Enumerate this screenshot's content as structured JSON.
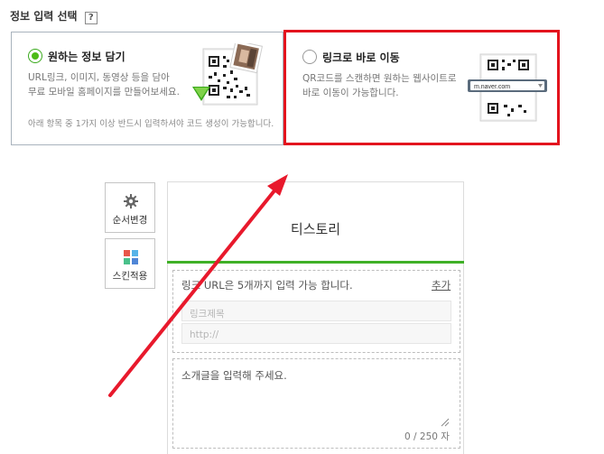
{
  "section": {
    "title": "정보 입력 선택",
    "help": "?"
  },
  "options": [
    {
      "title": "원하는 정보 담기",
      "desc_line1": "URL링크, 이미지, 동영상 등을 담아",
      "desc_line2": "무료 모바일 홈페이지를 만들어보세요.",
      "note": "아래 항목 중 1가지 이상 반드시 입력하셔야 코드 생성이 가능합니다.",
      "selected": true
    },
    {
      "title": "링크로 바로 이동",
      "desc_line1": "QR코드를 스캔하면 원하는 웹사이트로",
      "desc_line2": "바로 이동이 가능합니다.",
      "url_sample": "m.naver.com",
      "selected": false
    }
  ],
  "side_buttons": [
    {
      "label": "순서변경",
      "icon": "gear-icon"
    },
    {
      "label": "스킨적용",
      "icon": "skin-grid-icon"
    }
  ],
  "editor": {
    "title": "티스토리",
    "link_info": "링크 URL은 5개까지 입력 가능 합니다.",
    "add_label": "추가",
    "link_title_placeholder": "링크제목",
    "link_url_placeholder": "http://",
    "intro_placeholder": "소개글을 입력해 주세요.",
    "counter": "0 / 250 자"
  },
  "colors": {
    "accent_green": "#3fb027",
    "highlight_red": "#e3141e",
    "arrow_red": "#e8192c"
  }
}
